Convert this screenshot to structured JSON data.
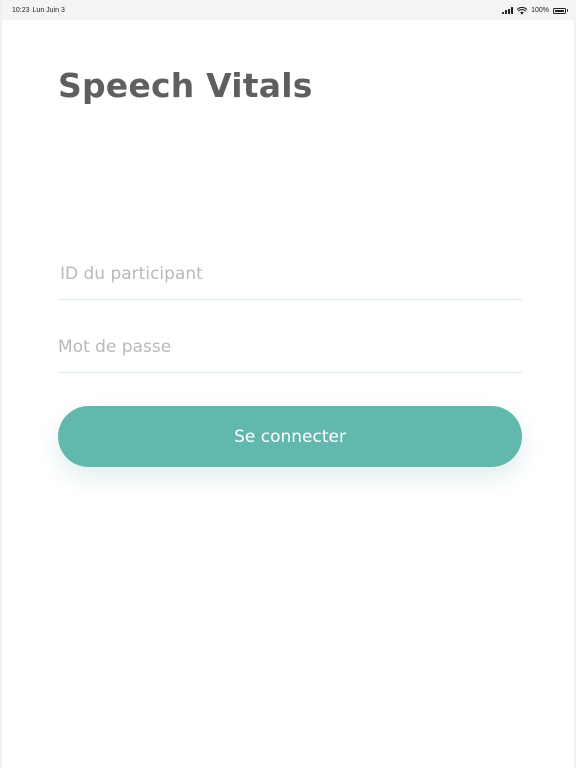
{
  "status_bar": {
    "time": "10:23",
    "date": "Lun Juin 3",
    "battery_percent": "100%",
    "battery_level": 1.0
  },
  "app": {
    "title": "Speech Vitals"
  },
  "login_form": {
    "participant_id": {
      "value": "",
      "placeholder": "ID du participant"
    },
    "password": {
      "value": "",
      "placeholder": "Mot de passe"
    },
    "submit_label": "Se connecter"
  },
  "colors": {
    "accent": "#62b8ad",
    "title_text": "#5f5f5f",
    "placeholder_text": "#b9b9b9",
    "field_underline": "#d6ecea",
    "button_text": "#ffffff",
    "background": "#ffffff"
  },
  "icons": {
    "signal": "cellular-signal-icon",
    "wifi": "wifi-icon",
    "battery": "battery-icon"
  }
}
